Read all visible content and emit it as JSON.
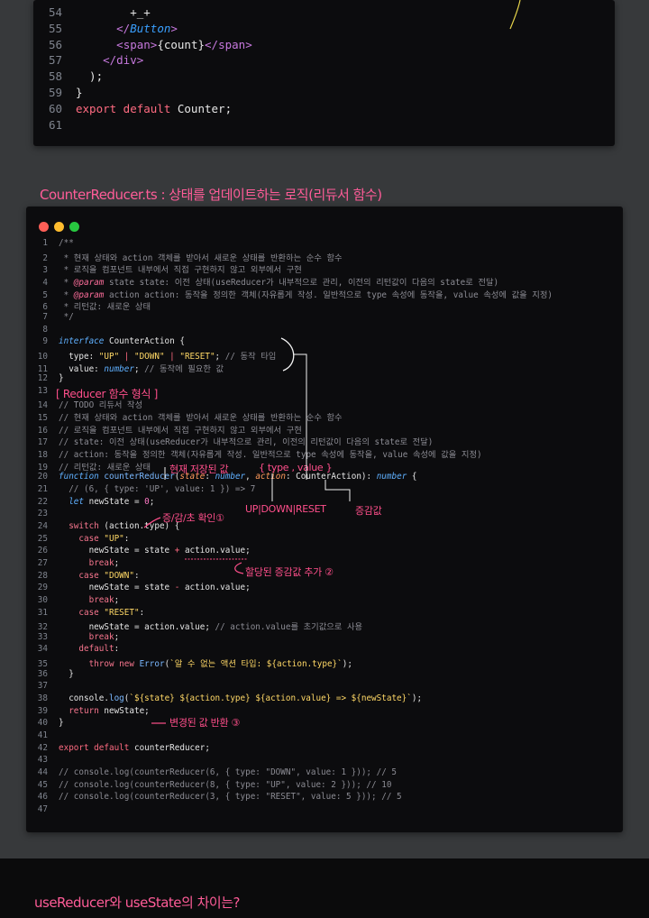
{
  "top_code": {
    "lines": [
      {
        "n": "54",
        "parts": [
          {
            "t": "        ",
            "c": "c-txt"
          },
          {
            "t": "+_+",
            "c": "c-txt"
          }
        ]
      },
      {
        "n": "55",
        "parts": [
          {
            "t": "      </",
            "c": "c-tag"
          },
          {
            "t": "Button",
            "c": "c-comp"
          },
          {
            "t": ">",
            "c": "c-tag"
          }
        ]
      },
      {
        "n": "56",
        "parts": [
          {
            "t": "      <",
            "c": "c-tag"
          },
          {
            "t": "span",
            "c": "c-tag"
          },
          {
            "t": ">",
            "c": "c-tag"
          },
          {
            "t": "{count}",
            "c": "c-txt"
          },
          {
            "t": "</",
            "c": "c-tag"
          },
          {
            "t": "span",
            "c": "c-tag"
          },
          {
            "t": ">",
            "c": "c-tag"
          }
        ]
      },
      {
        "n": "57",
        "parts": [
          {
            "t": "    </",
            "c": "c-tag"
          },
          {
            "t": "div",
            "c": "c-tag"
          },
          {
            "t": ">",
            "c": "c-tag"
          }
        ]
      },
      {
        "n": "58",
        "parts": [
          {
            "t": "  );",
            "c": "c-txt"
          }
        ]
      },
      {
        "n": "59",
        "parts": [
          {
            "t": "}",
            "c": "c-txt"
          }
        ]
      },
      {
        "n": "60",
        "parts": [
          {
            "t": "export default",
            "c": "c-kw"
          },
          {
            "t": " Counter;",
            "c": "c-txt"
          }
        ]
      },
      {
        "n": "61",
        "parts": []
      }
    ]
  },
  "section_title": "CounterReducer.ts : 상태를 업데이트하는 로직(리듀서 함수)",
  "main_code": {
    "lines": [
      {
        "n": "1",
        "parts": [
          {
            "t": "/**",
            "c": "c-cmt"
          }
        ]
      },
      {
        "n": "2",
        "parts": [
          {
            "t": " * 현재 상태와 action 객체를 받아서 새로운 상태를 반환하는 순수 함수",
            "c": "c-cmt"
          }
        ]
      },
      {
        "n": "3",
        "parts": [
          {
            "t": " * 로직을 컴포넌트 내부에서 직접 구현하지 않고 외부에서 구현",
            "c": "c-cmt"
          }
        ]
      },
      {
        "n": "4",
        "parts": [
          {
            "t": " * ",
            "c": "c-cmt"
          },
          {
            "t": "@param",
            "c": "c-doc"
          },
          {
            "t": " state state: 이전 상태(useReducer가 내부적으로 관리, 이전의 리턴값이 다음의 state로 전달)",
            "c": "c-cmt"
          }
        ]
      },
      {
        "n": "5",
        "parts": [
          {
            "t": " * ",
            "c": "c-cmt"
          },
          {
            "t": "@param",
            "c": "c-doc"
          },
          {
            "t": " action action: 동작을 정의한 객체(자유롭게 작성. 일반적으로 type 속성에 동작을, value 속성에 값을 지정)",
            "c": "c-cmt"
          }
        ]
      },
      {
        "n": "6",
        "parts": [
          {
            "t": " * 리턴값: 새로운 상태",
            "c": "c-cmt"
          }
        ]
      },
      {
        "n": "7",
        "parts": [
          {
            "t": " */",
            "c": "c-cmt"
          }
        ]
      },
      {
        "n": "8",
        "parts": []
      },
      {
        "n": "9",
        "parts": [
          {
            "t": "interface",
            "c": "c-type"
          },
          {
            "t": " CounterAction {",
            "c": "c-txt"
          }
        ]
      },
      {
        "n": "10",
        "parts": [
          {
            "t": "  type: ",
            "c": "c-txt"
          },
          {
            "t": "\"UP\"",
            "c": "c-str"
          },
          {
            "t": " | ",
            "c": "c-kw"
          },
          {
            "t": "\"DOWN\"",
            "c": "c-str"
          },
          {
            "t": " | ",
            "c": "c-kw"
          },
          {
            "t": "\"RESET\"",
            "c": "c-str"
          },
          {
            "t": "; ",
            "c": "c-txt"
          },
          {
            "t": "// 동작 타입",
            "c": "c-cmt"
          }
        ]
      },
      {
        "n": "11",
        "parts": [
          {
            "t": "  value: ",
            "c": "c-txt"
          },
          {
            "t": "number",
            "c": "c-type"
          },
          {
            "t": "; ",
            "c": "c-txt"
          },
          {
            "t": "// 동작에 필요한 값",
            "c": "c-cmt"
          }
        ]
      },
      {
        "n": "12",
        "parts": [
          {
            "t": "}",
            "c": "c-txt"
          }
        ]
      },
      {
        "n": "13",
        "parts": []
      },
      {
        "n": "14",
        "parts": [
          {
            "t": "// TODO 리듀서 작성",
            "c": "c-cmt"
          }
        ]
      },
      {
        "n": "15",
        "parts": [
          {
            "t": "// 현재 상태와 action 객체를 받아서 새로운 상태를 반환하는 순수 함수",
            "c": "c-cmt"
          }
        ]
      },
      {
        "n": "16",
        "parts": [
          {
            "t": "// 로직을 컴포넌트 내부에서 직접 구현하지 않고 외부에서 구현",
            "c": "c-cmt"
          }
        ]
      },
      {
        "n": "17",
        "parts": [
          {
            "t": "// state: 이전 상태(useReducer가 내부적으로 관리, 이전의 리턴값이 다음의 state로 전달)",
            "c": "c-cmt"
          }
        ]
      },
      {
        "n": "18",
        "parts": [
          {
            "t": "// action: 동작을 정의한 객체(자유롭게 작성. 일반적으로 type 속성에 동작을, value 속성에 값을 지정)",
            "c": "c-cmt"
          }
        ]
      },
      {
        "n": "19",
        "parts": [
          {
            "t": "// 리턴값: 새로운 상태",
            "c": "c-cmt"
          }
        ]
      },
      {
        "n": "20",
        "parts": [
          {
            "t": "function",
            "c": "c-type"
          },
          {
            "t": " counterReducer",
            "c": "c-fn"
          },
          {
            "t": "(",
            "c": "c-txt"
          },
          {
            "t": "state",
            "c": "c-par"
          },
          {
            "t": ": ",
            "c": "c-txt"
          },
          {
            "t": "number",
            "c": "c-type"
          },
          {
            "t": ", ",
            "c": "c-txt"
          },
          {
            "t": "action",
            "c": "c-par"
          },
          {
            "t": ": CounterAction): ",
            "c": "c-txt"
          },
          {
            "t": "number",
            "c": "c-type"
          },
          {
            "t": " {",
            "c": "c-txt"
          }
        ]
      },
      {
        "n": "21",
        "parts": [
          {
            "t": "  // (6, { type: 'UP', value: 1 }) => 7",
            "c": "c-cmt"
          }
        ]
      },
      {
        "n": "22",
        "parts": [
          {
            "t": "  ",
            "c": "c-txt"
          },
          {
            "t": "let",
            "c": "c-type"
          },
          {
            "t": " newState = ",
            "c": "c-txt"
          },
          {
            "t": "0",
            "c": "c-num"
          },
          {
            "t": ";",
            "c": "c-txt"
          }
        ]
      },
      {
        "n": "23",
        "parts": []
      },
      {
        "n": "24",
        "parts": [
          {
            "t": "  ",
            "c": "c-txt"
          },
          {
            "t": "switch",
            "c": "c-ctl"
          },
          {
            "t": " (action.type) {",
            "c": "c-txt"
          }
        ]
      },
      {
        "n": "25",
        "parts": [
          {
            "t": "    ",
            "c": "c-txt"
          },
          {
            "t": "case",
            "c": "c-ctl"
          },
          {
            "t": " ",
            "c": "c-txt"
          },
          {
            "t": "\"UP\"",
            "c": "c-str"
          },
          {
            "t": ":",
            "c": "c-txt"
          }
        ]
      },
      {
        "n": "26",
        "parts": [
          {
            "t": "      newState = state ",
            "c": "c-txt"
          },
          {
            "t": "+",
            "c": "c-kw"
          },
          {
            "t": " action.value;",
            "c": "c-txt"
          }
        ]
      },
      {
        "n": "27",
        "parts": [
          {
            "t": "      ",
            "c": "c-txt"
          },
          {
            "t": "break",
            "c": "c-ctl"
          },
          {
            "t": ";",
            "c": "c-txt"
          }
        ]
      },
      {
        "n": "28",
        "parts": [
          {
            "t": "    ",
            "c": "c-txt"
          },
          {
            "t": "case",
            "c": "c-ctl"
          },
          {
            "t": " ",
            "c": "c-txt"
          },
          {
            "t": "\"DOWN\"",
            "c": "c-str"
          },
          {
            "t": ":",
            "c": "c-txt"
          }
        ]
      },
      {
        "n": "29",
        "parts": [
          {
            "t": "      newState = state ",
            "c": "c-txt"
          },
          {
            "t": "-",
            "c": "c-kw"
          },
          {
            "t": " action.value;",
            "c": "c-txt"
          }
        ]
      },
      {
        "n": "30",
        "parts": [
          {
            "t": "      ",
            "c": "c-txt"
          },
          {
            "t": "break",
            "c": "c-ctl"
          },
          {
            "t": ";",
            "c": "c-txt"
          }
        ]
      },
      {
        "n": "31",
        "parts": [
          {
            "t": "    ",
            "c": "c-txt"
          },
          {
            "t": "case",
            "c": "c-ctl"
          },
          {
            "t": " ",
            "c": "c-txt"
          },
          {
            "t": "\"RESET\"",
            "c": "c-str"
          },
          {
            "t": ":",
            "c": "c-txt"
          }
        ]
      },
      {
        "n": "32",
        "parts": [
          {
            "t": "      newState = action.value; ",
            "c": "c-txt"
          },
          {
            "t": "// action.value를 초기값으로 사용",
            "c": "c-cmt"
          }
        ]
      },
      {
        "n": "33",
        "parts": [
          {
            "t": "      ",
            "c": "c-txt"
          },
          {
            "t": "break",
            "c": "c-ctl"
          },
          {
            "t": ";",
            "c": "c-txt"
          }
        ]
      },
      {
        "n": "34",
        "parts": [
          {
            "t": "    ",
            "c": "c-txt"
          },
          {
            "t": "default",
            "c": "c-ctl"
          },
          {
            "t": ":",
            "c": "c-txt"
          }
        ]
      },
      {
        "n": "35",
        "parts": [
          {
            "t": "      ",
            "c": "c-txt"
          },
          {
            "t": "throw new",
            "c": "c-ctl"
          },
          {
            "t": " ",
            "c": "c-txt"
          },
          {
            "t": "Error",
            "c": "c-fn"
          },
          {
            "t": "(",
            "c": "c-txt"
          },
          {
            "t": "`알 수 없는 액션 타입: ${action.type}`",
            "c": "c-str"
          },
          {
            "t": ");",
            "c": "c-txt"
          }
        ]
      },
      {
        "n": "36",
        "parts": [
          {
            "t": "  }",
            "c": "c-txt"
          }
        ]
      },
      {
        "n": "37",
        "parts": []
      },
      {
        "n": "38",
        "parts": [
          {
            "t": "  console.",
            "c": "c-txt"
          },
          {
            "t": "log",
            "c": "c-fn"
          },
          {
            "t": "(",
            "c": "c-txt"
          },
          {
            "t": "`${state} ${action.type} ${action.value} => ${newState}`",
            "c": "c-str"
          },
          {
            "t": ");",
            "c": "c-txt"
          }
        ]
      },
      {
        "n": "39",
        "parts": [
          {
            "t": "  ",
            "c": "c-txt"
          },
          {
            "t": "return",
            "c": "c-ctl"
          },
          {
            "t": " newState;",
            "c": "c-txt"
          }
        ]
      },
      {
        "n": "40",
        "parts": [
          {
            "t": "}",
            "c": "c-txt"
          }
        ]
      },
      {
        "n": "41",
        "parts": []
      },
      {
        "n": "42",
        "parts": [
          {
            "t": "export default",
            "c": "c-kw"
          },
          {
            "t": " counterReducer;",
            "c": "c-txt"
          }
        ]
      },
      {
        "n": "43",
        "parts": []
      },
      {
        "n": "44",
        "parts": [
          {
            "t": "// console.log(counterReducer(6, { type: \"DOWN\", value: 1 })); // 5",
            "c": "c-cmt"
          }
        ]
      },
      {
        "n": "45",
        "parts": [
          {
            "t": "// console.log(counterReducer(8, { type: \"UP\", value: 2 })); // 10",
            "c": "c-cmt"
          }
        ]
      },
      {
        "n": "46",
        "parts": [
          {
            "t": "// console.log(counterReducer(3, { type: \"RESET\", value: 5 })); // 5",
            "c": "c-cmt"
          }
        ]
      },
      {
        "n": "47",
        "parts": []
      }
    ]
  },
  "annotations": {
    "reducer_label": "[ Reducer 함수 형식 ]",
    "current_value": "현재 저장된 값",
    "type_value": "{ type , value }",
    "up_down_reset": "UP|DOWN|RESET",
    "amount": "증감값",
    "check": "증/감/초 확인①",
    "add_amount": "할당된 증감값 추가 ②",
    "return_changed": "변경된 값 반환 ③"
  },
  "bottom_note": "useReducer와 useState의 차이는?",
  "colors": {
    "traffic_red": "#ff5f57",
    "traffic_yellow": "#febc2e",
    "traffic_green": "#28c840",
    "annotation_pink": "#ff4f8b"
  }
}
